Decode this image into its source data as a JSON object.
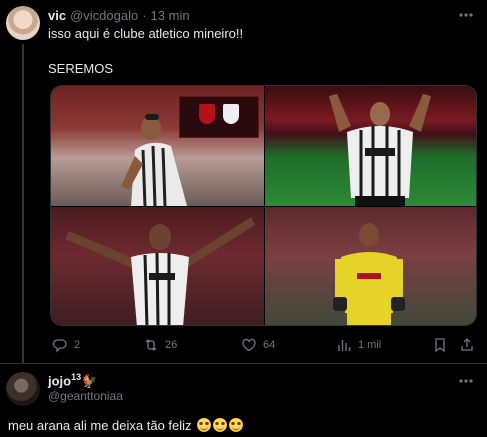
{
  "tweet": {
    "author_name": "vic",
    "author_handle": "@vicdogalo",
    "separator": "·",
    "time": "13 min",
    "text_line1": "isso aqui é clube atletico mineiro!!",
    "text_line2": "SEREMOS",
    "media_count": 4,
    "actions": {
      "replies": "2",
      "retweets": "26",
      "likes": "64",
      "views": "1 mil"
    }
  },
  "reply": {
    "author_name": "jojo",
    "author_sup": "13",
    "author_emoji": "🐓",
    "author_handle": "@geanttoniaa",
    "text": "meu arana ali me deixa tão feliz",
    "trailing_emojis": [
      "smiling-face-with-tear",
      "smiling-face-with-tear",
      "smiling-face-with-tear"
    ]
  },
  "colors": {
    "background": "#000000",
    "text_primary": "#e7e9ea",
    "text_secondary": "#71767b",
    "divider": "#2f3336"
  }
}
